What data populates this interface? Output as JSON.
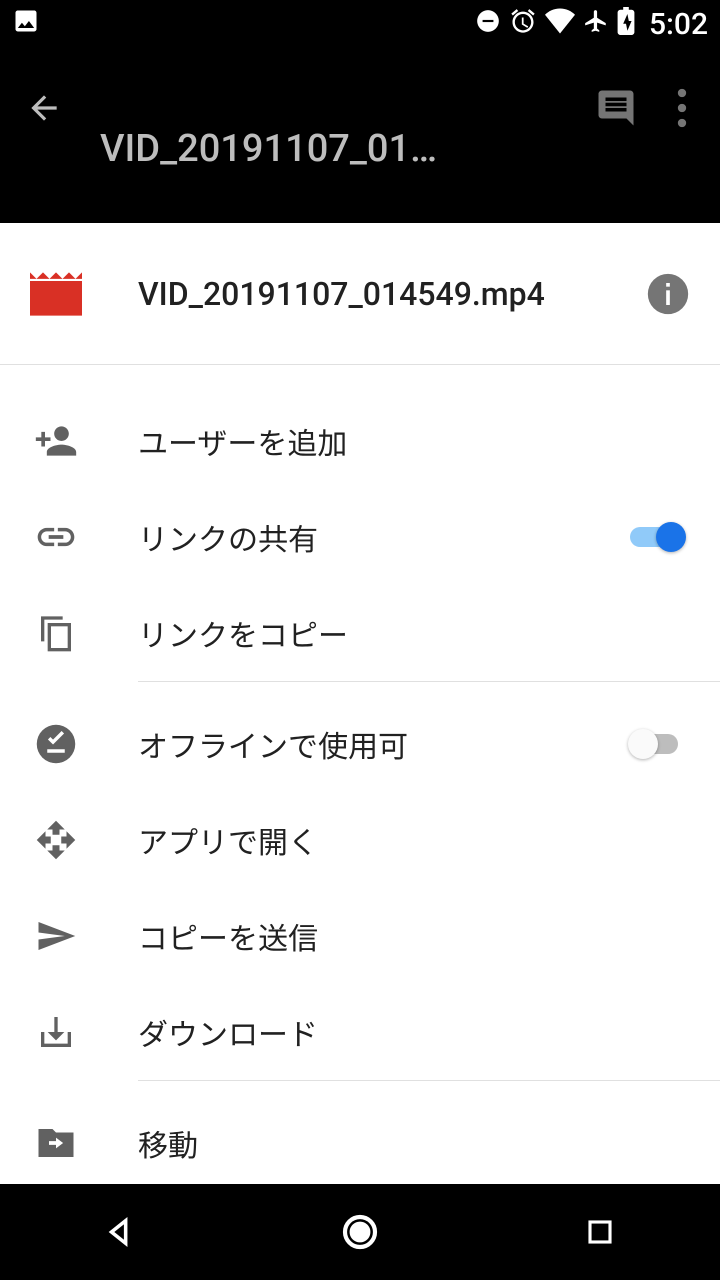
{
  "status": {
    "time": "5:02"
  },
  "appbar": {
    "title": "VID_20191107_01…"
  },
  "file": {
    "name": "VID_20191107_014549.mp4"
  },
  "options": {
    "add_user": "ユーザーを追加",
    "link_share": "リンクの共有",
    "copy_link": "リンクをコピー",
    "offline": "オフラインで使用可",
    "open_with": "アプリで開く",
    "send_copy": "コピーを送信",
    "download": "ダウンロード",
    "move": "移動"
  },
  "toggles": {
    "link_share": true,
    "offline": false
  }
}
